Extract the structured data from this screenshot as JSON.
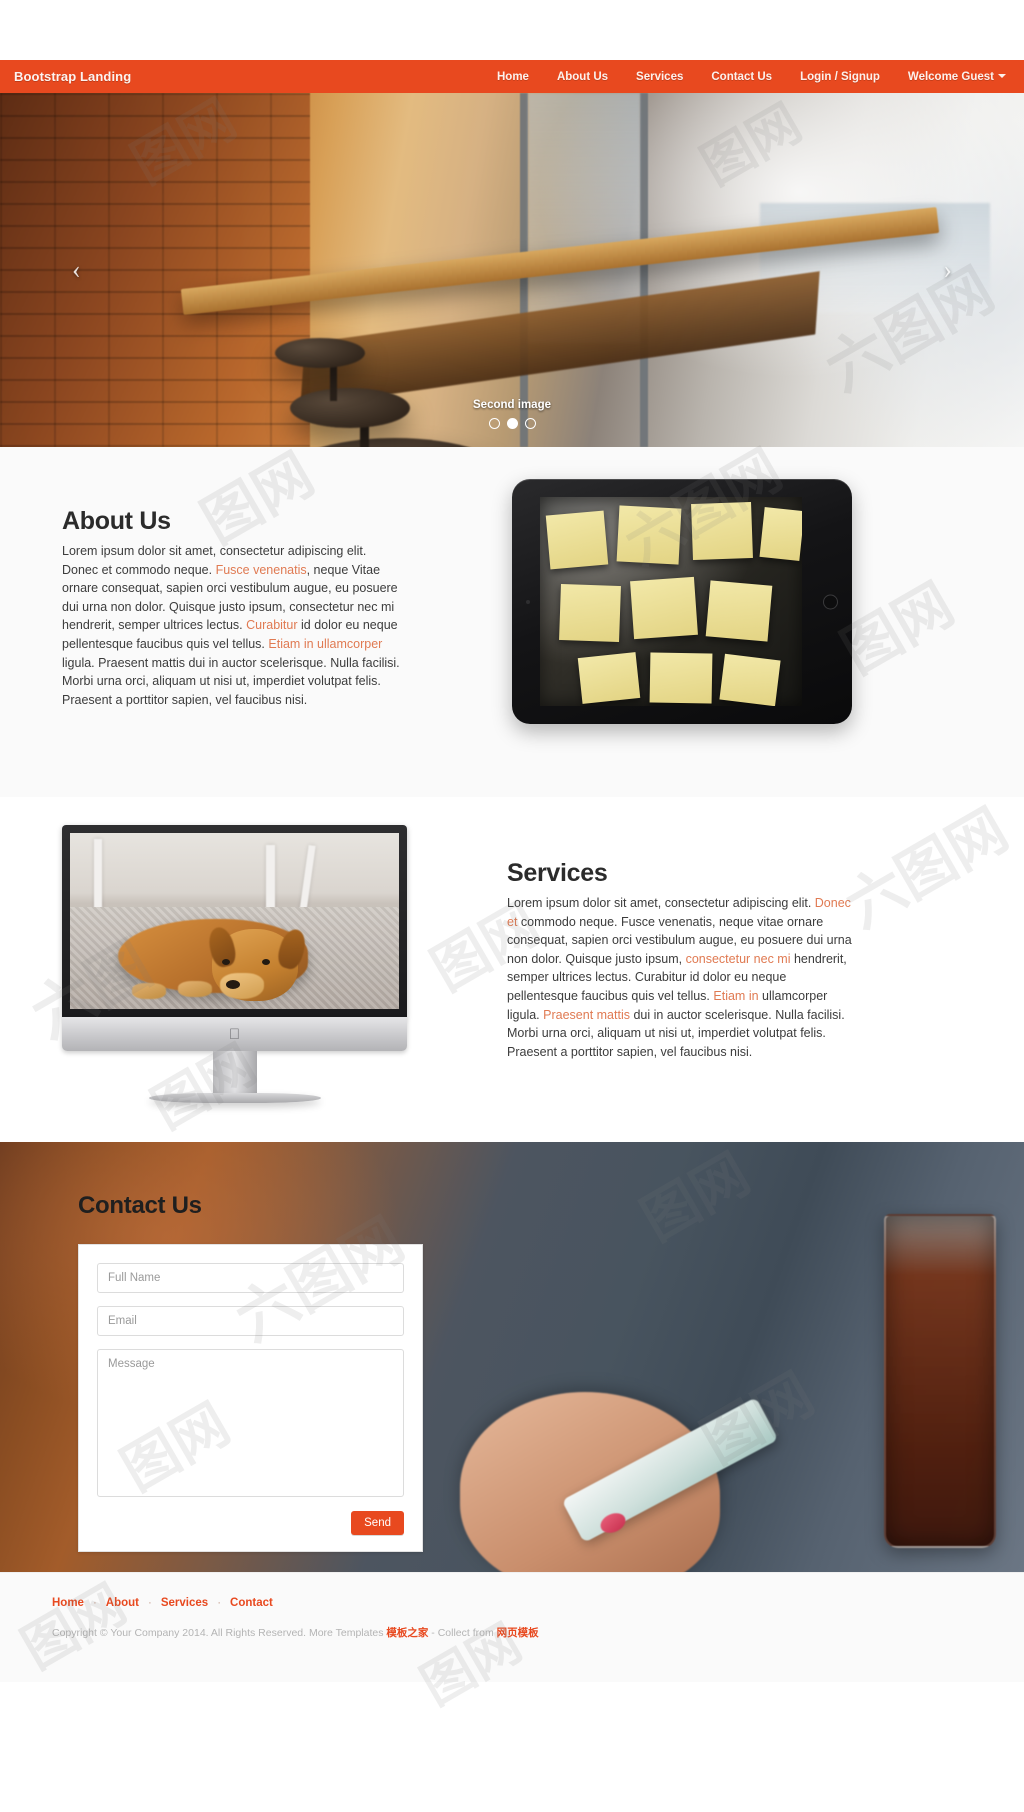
{
  "navbar": {
    "brand": "Bootstrap Landing",
    "links": [
      {
        "label": "Home"
      },
      {
        "label": "About Us"
      },
      {
        "label": "Services"
      },
      {
        "label": "Contact Us"
      },
      {
        "label": "Login / Signup"
      },
      {
        "label": "Welcome Guest"
      }
    ],
    "bg_color": "#e8491f",
    "text_color": "#fdf1ec"
  },
  "carousel": {
    "caption": "Second image",
    "prev_glyph": "‹",
    "next_glyph": "›",
    "slide_count": 3,
    "active_slide": 2
  },
  "about": {
    "title": "About Us",
    "p1": "Lorem ipsum dolor sit amet, consectetur adipiscing elit. Donec et commodo neque. ",
    "hl1": "Fusce venenatis",
    "p2": ", neque Vitae ornare consequat, sapien orci vestibulum augue, eu posuere dui urna non dolor. Quisque justo ipsum, consectetur nec mi hendrerit, semper ultrices lectus. ",
    "hl2": "Curabitur",
    "p3": " id dolor eu neque pellentesque faucibus quis vel tellus. ",
    "hl3": "Etiam in ullamcorper",
    "p4": " ligula. Praesent mattis dui in auctor scelerisque. Nulla facilisi. Morbi urna orci, aliquam ut nisi ut, imperdiet volutpat felis. Praesent a porttitor sapien, vel faucibus nisi."
  },
  "services": {
    "title": "Services",
    "p1": "Lorem ipsum dolor sit amet, consectetur adipiscing elit. ",
    "hl1": "Donec et",
    "p2": " commodo neque. Fusce venenatis, neque vitae ornare consequat, sapien orci vestibulum augue, eu posuere dui urna non dolor. Quisque justo ipsum, ",
    "hl2": "consectetur nec mi",
    "p3": " hendrerit, semper ultrices lectus. Curabitur id dolor eu neque pellentesque faucibus quis vel tellus. ",
    "hl3": "Etiam in",
    "p4": " ullamcorper ligula. ",
    "hl4": "Praesent mattis",
    "p5": " dui in auctor scelerisque. Nulla facilisi. Morbi urna orci, aliquam ut nisi ut, imperdiet volutpat felis. Praesent a porttitor sapien, vel faucibus nisi."
  },
  "contact": {
    "title": "Contact Us",
    "fullname_placeholder": "Full Name",
    "fullname_value": "",
    "email_placeholder": "Email",
    "email_value": "",
    "message_placeholder": "Message",
    "message_value": "",
    "send_label": "Send"
  },
  "footer": {
    "links": [
      {
        "label": "Home"
      },
      {
        "label": "About"
      },
      {
        "label": "Services"
      },
      {
        "label": "Contact"
      }
    ],
    "separator": "·",
    "copyright_a": "Copyright © Your Company 2014. All Rights Reserved. More Templates ",
    "copyright_cn1": "模板之家",
    "copyright_b": " - Collect from ",
    "copyright_cn2": "网页模板"
  },
  "watermark": {
    "mark1": "图网",
    "mark2": "图网",
    "mark3": "六图网",
    "mark4": "图网",
    "mark5": "六图网",
    "mark6": "图网",
    "mark7": "六图",
    "mark8": "图网"
  }
}
